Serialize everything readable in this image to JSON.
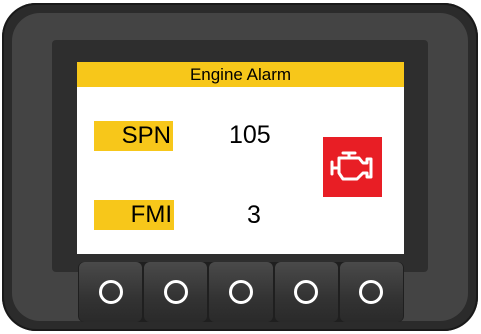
{
  "screen": {
    "title": "Engine Alarm",
    "accent_color": "#f7c71a",
    "alarm_color": "#e81e25"
  },
  "fields": [
    {
      "label": "SPN",
      "value": "105"
    },
    {
      "label": "FMI",
      "value": "3"
    }
  ],
  "indicator": {
    "icon": "check-engine-icon"
  },
  "buttons": [
    {
      "icon": "circle-button-icon"
    },
    {
      "icon": "circle-button-icon"
    },
    {
      "icon": "circle-button-icon"
    },
    {
      "icon": "circle-button-icon"
    },
    {
      "icon": "circle-button-icon"
    }
  ]
}
